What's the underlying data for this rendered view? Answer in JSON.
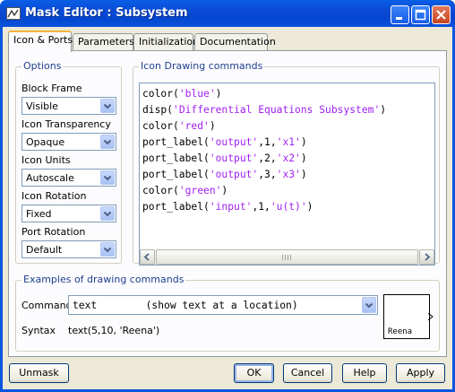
{
  "window": {
    "title": "Mask Editor : Subsystem",
    "titlebar_color": "#0a56df",
    "controls": [
      "minimize-icon",
      "maximize-icon",
      "close-icon"
    ]
  },
  "tabs": [
    {
      "label": "Icon & Ports",
      "active": true
    },
    {
      "label": "Parameters",
      "active": false
    },
    {
      "label": "Initialization",
      "active": false
    },
    {
      "label": "Documentation",
      "active": false
    }
  ],
  "options": {
    "group_label": "Options",
    "fields": [
      {
        "label": "Block Frame",
        "value": "Visible"
      },
      {
        "label": "Icon Transparency",
        "value": "Opaque"
      },
      {
        "label": "Icon Units",
        "value": "Autoscale"
      },
      {
        "label": "Icon Rotation",
        "value": "Fixed"
      },
      {
        "label": "Port Rotation",
        "value": "Default"
      }
    ]
  },
  "drawing": {
    "group_label": "Icon Drawing commands",
    "lines": [
      {
        "pre": "color(",
        "str": "'blue'",
        "post": ")"
      },
      {
        "pre": "disp(",
        "str": "'Differential Equations Subsystem'",
        "post": ")"
      },
      {
        "pre": "color(",
        "str": "'red'",
        "post": ")"
      },
      {
        "pre": "port_label(",
        "str": "'output'",
        "post": ",1,",
        "str2": "'x1'",
        "post2": ")"
      },
      {
        "pre": "port_label(",
        "str": "'output'",
        "post": ",2,",
        "str2": "'x2'",
        "post2": ")"
      },
      {
        "pre": "port_label(",
        "str": "'output'",
        "post": ",3,",
        "str2": "'x3'",
        "post2": ")"
      },
      {
        "pre": "color(",
        "str": "'green'",
        "post": ")"
      },
      {
        "pre": "port_label(",
        "str": "'input'",
        "post": ",1,",
        "str2": "'u(t)'",
        "post2": ")"
      }
    ],
    "string_color": "#a020f0"
  },
  "examples": {
    "group_label": "Examples of drawing commands",
    "command_label": "Command",
    "command_value": "text        (show text at a location)",
    "syntax_label": "Syntax",
    "syntax_value": "text(5,10, 'Reena')",
    "preview_text": "Reena"
  },
  "buttons": {
    "unmask": "Unmask",
    "ok": "OK",
    "cancel": "Cancel",
    "help": "Help",
    "apply": "Apply"
  }
}
